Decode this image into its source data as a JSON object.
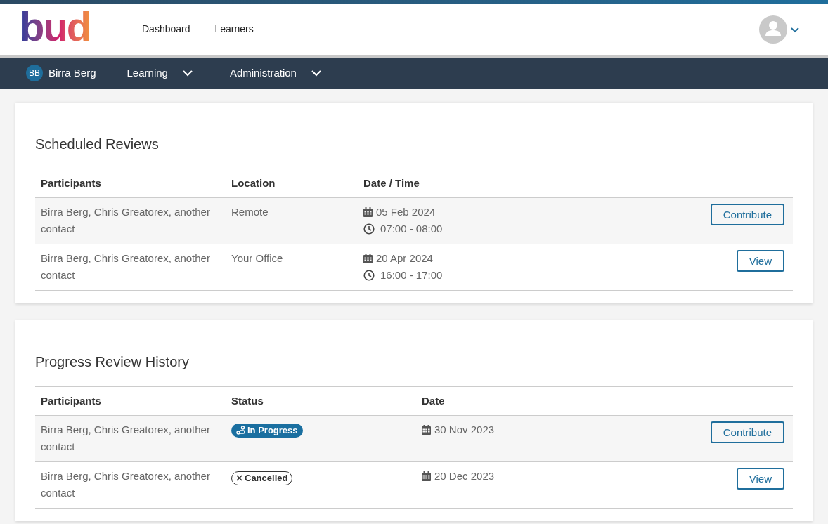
{
  "logo": {
    "text": "bud"
  },
  "top_nav": [
    {
      "label": "Dashboard"
    },
    {
      "label": "Learners"
    }
  ],
  "sub_nav": {
    "user": {
      "initials": "BB",
      "name": "Birra Berg"
    },
    "menus": [
      {
        "label": "Learning"
      },
      {
        "label": "Administration"
      }
    ]
  },
  "scheduled_reviews": {
    "title": "Scheduled Reviews",
    "columns": [
      "Participants",
      "Location",
      "Date / Time"
    ],
    "rows": [
      {
        "participants": "Birra Berg, Chris Greatorex, another contact",
        "location": "Remote",
        "date": "05 Feb 2024",
        "time": "07:00 - 08:00",
        "action": "Contribute"
      },
      {
        "participants": "Birra Berg, Chris Greatorex, another contact",
        "location": "Your Office",
        "date": "20 Apr 2024",
        "time": "16:00 - 17:00",
        "action": "View"
      }
    ]
  },
  "history": {
    "title": "Progress Review History",
    "columns": [
      "Participants",
      "Status",
      "Date"
    ],
    "rows": [
      {
        "participants": "Birra Berg, Chris Greatorex, another contact",
        "status": {
          "kind": "in_progress",
          "label": "In Progress"
        },
        "date": "30 Nov 2023",
        "action": "Contribute"
      },
      {
        "participants": "Birra Berg, Chris Greatorex, another contact",
        "status": {
          "kind": "cancelled",
          "label": "Cancelled"
        },
        "date": "20 Dec 2023",
        "action": "View"
      }
    ]
  }
}
